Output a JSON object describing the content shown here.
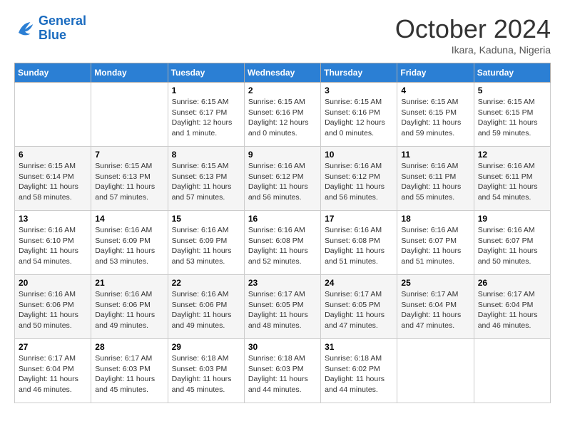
{
  "header": {
    "logo_line1": "General",
    "logo_line2": "Blue",
    "month": "October 2024",
    "location": "Ikara, Kaduna, Nigeria"
  },
  "weekdays": [
    "Sunday",
    "Monday",
    "Tuesday",
    "Wednesday",
    "Thursday",
    "Friday",
    "Saturday"
  ],
  "weeks": [
    [
      {
        "day": null
      },
      {
        "day": null
      },
      {
        "day": 1,
        "sunrise": "6:15 AM",
        "sunset": "6:17 PM",
        "daylight": "12 hours and 1 minute."
      },
      {
        "day": 2,
        "sunrise": "6:15 AM",
        "sunset": "6:16 PM",
        "daylight": "12 hours and 0 minutes."
      },
      {
        "day": 3,
        "sunrise": "6:15 AM",
        "sunset": "6:16 PM",
        "daylight": "12 hours and 0 minutes."
      },
      {
        "day": 4,
        "sunrise": "6:15 AM",
        "sunset": "6:15 PM",
        "daylight": "11 hours and 59 minutes."
      },
      {
        "day": 5,
        "sunrise": "6:15 AM",
        "sunset": "6:15 PM",
        "daylight": "11 hours and 59 minutes."
      }
    ],
    [
      {
        "day": 6,
        "sunrise": "6:15 AM",
        "sunset": "6:14 PM",
        "daylight": "11 hours and 58 minutes."
      },
      {
        "day": 7,
        "sunrise": "6:15 AM",
        "sunset": "6:13 PM",
        "daylight": "11 hours and 57 minutes."
      },
      {
        "day": 8,
        "sunrise": "6:15 AM",
        "sunset": "6:13 PM",
        "daylight": "11 hours and 57 minutes."
      },
      {
        "day": 9,
        "sunrise": "6:16 AM",
        "sunset": "6:12 PM",
        "daylight": "11 hours and 56 minutes."
      },
      {
        "day": 10,
        "sunrise": "6:16 AM",
        "sunset": "6:12 PM",
        "daylight": "11 hours and 56 minutes."
      },
      {
        "day": 11,
        "sunrise": "6:16 AM",
        "sunset": "6:11 PM",
        "daylight": "11 hours and 55 minutes."
      },
      {
        "day": 12,
        "sunrise": "6:16 AM",
        "sunset": "6:11 PM",
        "daylight": "11 hours and 54 minutes."
      }
    ],
    [
      {
        "day": 13,
        "sunrise": "6:16 AM",
        "sunset": "6:10 PM",
        "daylight": "11 hours and 54 minutes."
      },
      {
        "day": 14,
        "sunrise": "6:16 AM",
        "sunset": "6:09 PM",
        "daylight": "11 hours and 53 minutes."
      },
      {
        "day": 15,
        "sunrise": "6:16 AM",
        "sunset": "6:09 PM",
        "daylight": "11 hours and 53 minutes."
      },
      {
        "day": 16,
        "sunrise": "6:16 AM",
        "sunset": "6:08 PM",
        "daylight": "11 hours and 52 minutes."
      },
      {
        "day": 17,
        "sunrise": "6:16 AM",
        "sunset": "6:08 PM",
        "daylight": "11 hours and 51 minutes."
      },
      {
        "day": 18,
        "sunrise": "6:16 AM",
        "sunset": "6:07 PM",
        "daylight": "11 hours and 51 minutes."
      },
      {
        "day": 19,
        "sunrise": "6:16 AM",
        "sunset": "6:07 PM",
        "daylight": "11 hours and 50 minutes."
      }
    ],
    [
      {
        "day": 20,
        "sunrise": "6:16 AM",
        "sunset": "6:06 PM",
        "daylight": "11 hours and 50 minutes."
      },
      {
        "day": 21,
        "sunrise": "6:16 AM",
        "sunset": "6:06 PM",
        "daylight": "11 hours and 49 minutes."
      },
      {
        "day": 22,
        "sunrise": "6:16 AM",
        "sunset": "6:06 PM",
        "daylight": "11 hours and 49 minutes."
      },
      {
        "day": 23,
        "sunrise": "6:17 AM",
        "sunset": "6:05 PM",
        "daylight": "11 hours and 48 minutes."
      },
      {
        "day": 24,
        "sunrise": "6:17 AM",
        "sunset": "6:05 PM",
        "daylight": "11 hours and 47 minutes."
      },
      {
        "day": 25,
        "sunrise": "6:17 AM",
        "sunset": "6:04 PM",
        "daylight": "11 hours and 47 minutes."
      },
      {
        "day": 26,
        "sunrise": "6:17 AM",
        "sunset": "6:04 PM",
        "daylight": "11 hours and 46 minutes."
      }
    ],
    [
      {
        "day": 27,
        "sunrise": "6:17 AM",
        "sunset": "6:04 PM",
        "daylight": "11 hours and 46 minutes."
      },
      {
        "day": 28,
        "sunrise": "6:17 AM",
        "sunset": "6:03 PM",
        "daylight": "11 hours and 45 minutes."
      },
      {
        "day": 29,
        "sunrise": "6:18 AM",
        "sunset": "6:03 PM",
        "daylight": "11 hours and 45 minutes."
      },
      {
        "day": 30,
        "sunrise": "6:18 AM",
        "sunset": "6:03 PM",
        "daylight": "11 hours and 44 minutes."
      },
      {
        "day": 31,
        "sunrise": "6:18 AM",
        "sunset": "6:02 PM",
        "daylight": "11 hours and 44 minutes."
      },
      {
        "day": null
      },
      {
        "day": null
      }
    ]
  ]
}
